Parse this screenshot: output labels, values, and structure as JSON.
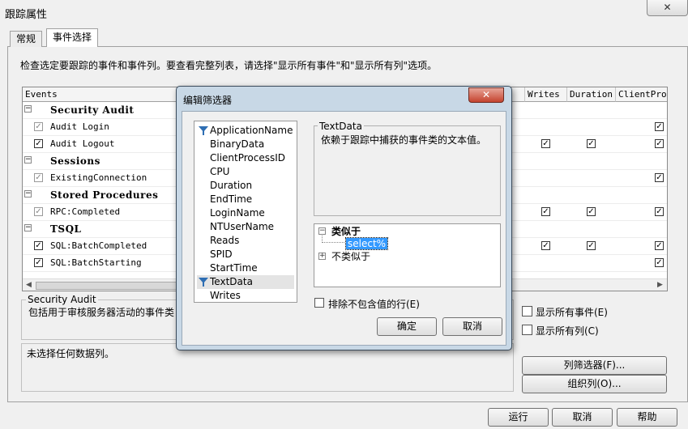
{
  "window": {
    "title": "跟踪属性",
    "close_glyph": "✕"
  },
  "tabs": [
    {
      "label": "常规"
    },
    {
      "label": "事件选择"
    }
  ],
  "instructions": "检查选定要跟踪的事件和事件列。要查看完整列表，请选择\"显示所有事件\"和\"显示所有列\"选项。",
  "grid": {
    "columns": [
      "Events",
      "Writes",
      "Duration",
      "ClientProc"
    ],
    "rows": [
      {
        "type": "group",
        "label": "Security Audit",
        "toggle": "−"
      },
      {
        "type": "event",
        "label": "Audit Login",
        "checked": true,
        "disabled": true
      },
      {
        "type": "event",
        "label": "Audit Logout",
        "checked": true,
        "disabled": false
      },
      {
        "type": "group",
        "label": "Sessions",
        "toggle": "−"
      },
      {
        "type": "event",
        "label": "ExistingConnection",
        "checked": true,
        "disabled": true
      },
      {
        "type": "group",
        "label": "Stored Procedures",
        "toggle": "−"
      },
      {
        "type": "event",
        "label": "RPC:Completed",
        "checked": true,
        "disabled": true
      },
      {
        "type": "group",
        "label": "TSQL",
        "toggle": "−"
      },
      {
        "type": "event",
        "label": "SQL:BatchCompleted",
        "checked": true,
        "disabled": false
      },
      {
        "type": "event",
        "label": "SQL:BatchStarting",
        "checked": true,
        "disabled": false
      }
    ],
    "check_glyph": "✓"
  },
  "description": {
    "legend": "Security Audit",
    "text": "包括用于审核服务器活动的事件类"
  },
  "no_data_text": "未选择任何数据列。",
  "options": {
    "show_all_events": "显示所有事件(E)",
    "show_all_columns": "显示所有列(C)"
  },
  "side_buttons": {
    "column_filter": "列筛选器(F)...",
    "organize_columns": "组织列(O)..."
  },
  "footer_buttons": {
    "run": "运行",
    "cancel": "取消",
    "help": "帮助"
  },
  "dialog": {
    "title": "编辑筛选器",
    "close_glyph": "✕",
    "columns": [
      {
        "label": "ApplicationName",
        "filtered": true
      },
      {
        "label": "BinaryData",
        "filtered": false
      },
      {
        "label": "ClientProcessID",
        "filtered": false
      },
      {
        "label": "CPU",
        "filtered": false
      },
      {
        "label": "Duration",
        "filtered": false
      },
      {
        "label": "EndTime",
        "filtered": false
      },
      {
        "label": "LoginName",
        "filtered": false
      },
      {
        "label": "NTUserName",
        "filtered": false
      },
      {
        "label": "Reads",
        "filtered": false
      },
      {
        "label": "SPID",
        "filtered": false
      },
      {
        "label": "StartTime",
        "filtered": false
      },
      {
        "label": "TextData",
        "filtered": true,
        "selected": true
      },
      {
        "label": "Writes",
        "filtered": false
      }
    ],
    "info_label": "TextData",
    "info_text": "依赖于跟踪中捕获的事件类的文本值。",
    "tree": {
      "like_label": "类似于",
      "like_value": "select%",
      "not_like_label": "不类似于",
      "expanded_toggle": "−",
      "collapsed_toggle": "+"
    },
    "exclude_label": "排除不包含值的行(E)",
    "ok": "确定",
    "cancel": "取消"
  }
}
